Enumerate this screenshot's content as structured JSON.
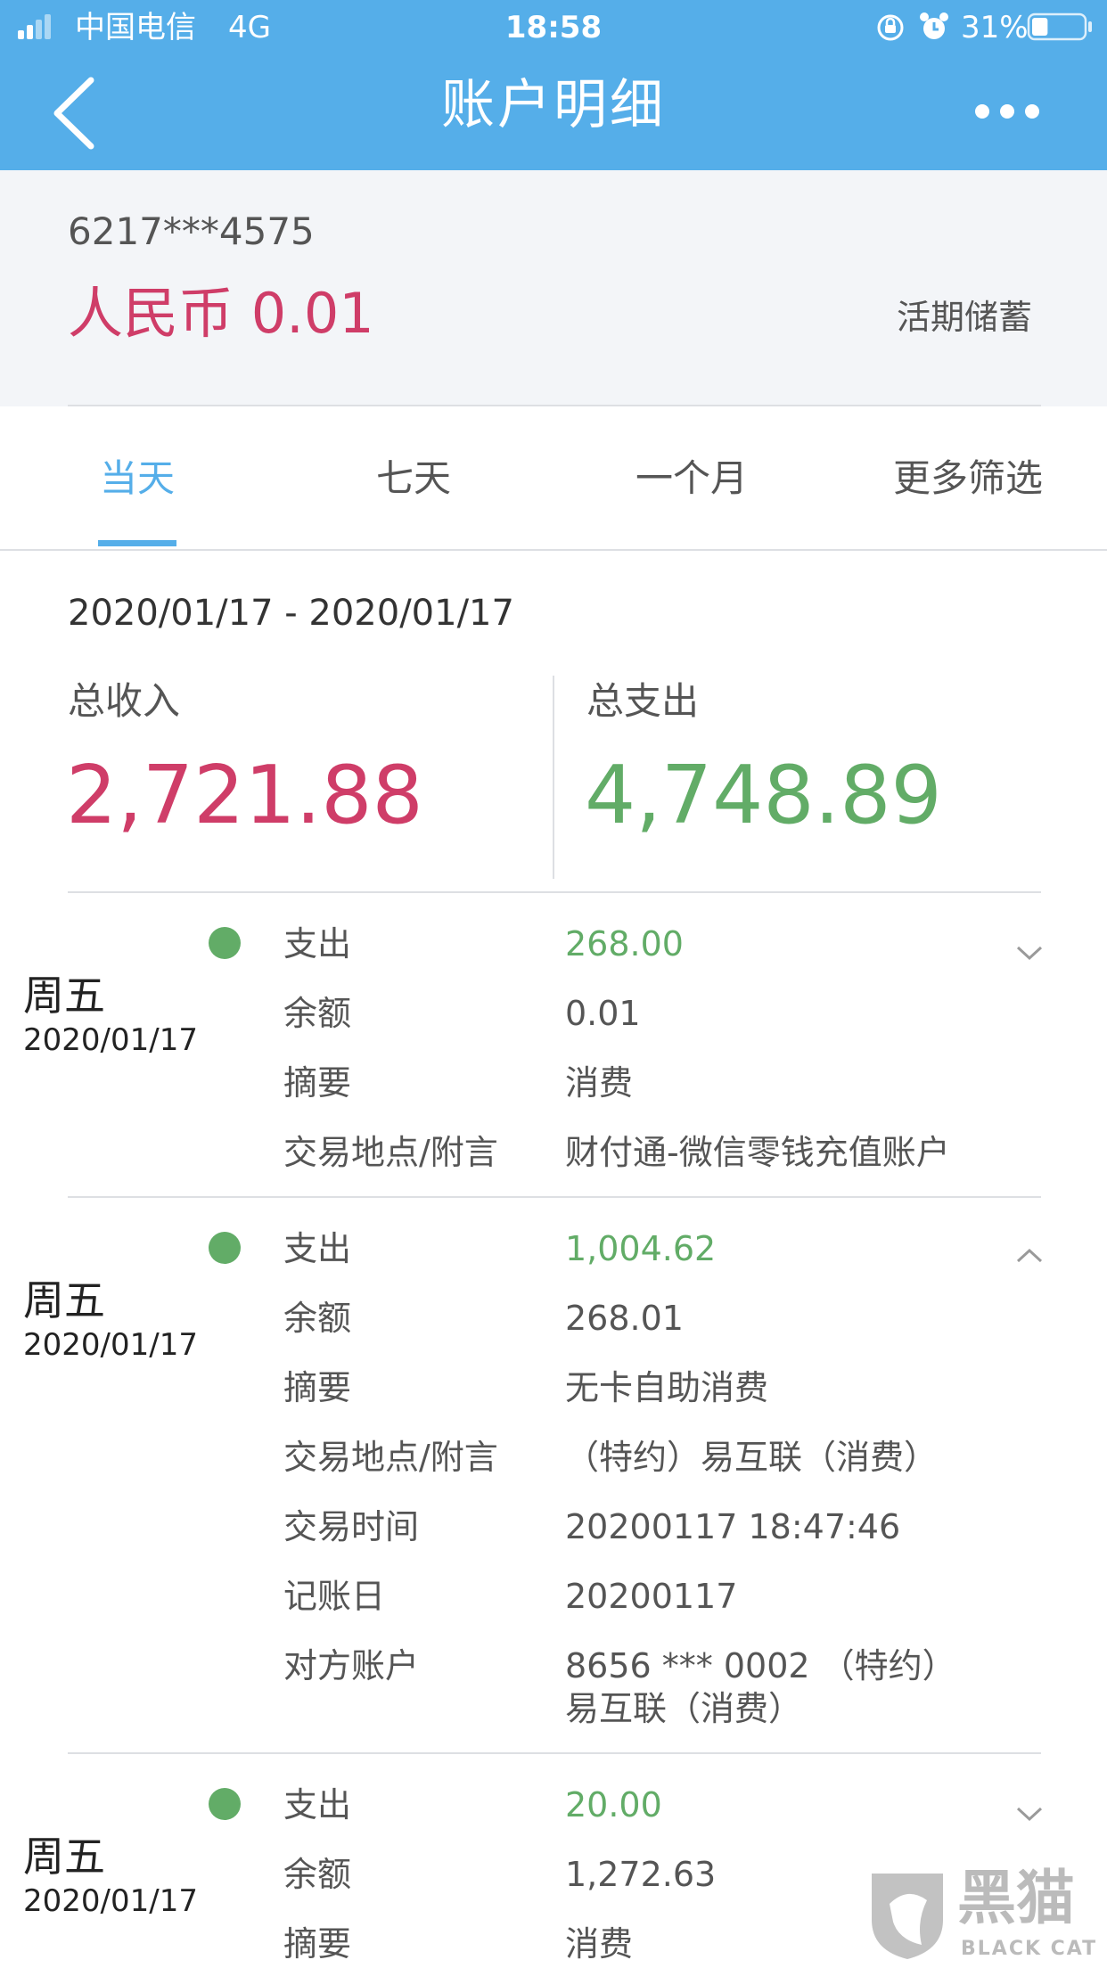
{
  "status_bar": {
    "carrier": "中国电信",
    "network": "4G",
    "time": "18:58",
    "battery": "31%",
    "battery_level": 0.31
  },
  "header": {
    "title": "账户明细"
  },
  "account": {
    "number": "6217***4575",
    "balance": "人民币 0.01",
    "type": "活期储蓄"
  },
  "tabs": [
    {
      "label": "当天"
    },
    {
      "label": "七天"
    },
    {
      "label": "一个月"
    },
    {
      "label": "更多筛选"
    }
  ],
  "summary": {
    "date_range": "2020/01/17 - 2020/01/17",
    "income_label": "总收入",
    "income_value": "2,721.88",
    "expense_label": "总支出",
    "expense_value": "4,748.89"
  },
  "transactions": [
    {
      "weekday": "周五",
      "date": "2020/01/17",
      "type_label": "支出",
      "amount": "268.00",
      "balance_label": "余额",
      "balance": "0.01",
      "summary_label": "摘要",
      "summary": "消费",
      "place_label": "交易地点/附言",
      "place": "财付通-微信零钱充值账户"
    },
    {
      "weekday": "周五",
      "date": "2020/01/17",
      "type_label": "支出",
      "amount": "1,004.62",
      "balance_label": "余额",
      "balance": "268.01",
      "summary_label": "摘要",
      "summary": "无卡自助消费",
      "place_label": "交易地点/附言",
      "place": "（特约）易互联（消费）",
      "time_label": "交易时间",
      "time": "20200117 18:47:46",
      "post_label": "记账日",
      "post_date": "20200117",
      "counterparty_label": "对方账户",
      "counterparty_line1": "8656 *** 0002 （特约）",
      "counterparty_line2": "易互联（消费）"
    },
    {
      "weekday": "周五",
      "date": "2020/01/17",
      "type_label": "支出",
      "amount": "20.00",
      "balance_label": "余额",
      "balance": "1,272.63",
      "summary_label": "摘要",
      "summary": "消费"
    }
  ],
  "watermark": {
    "cn": "黑猫",
    "en": "BLACK CAT"
  },
  "colors": {
    "header": "#55aee9",
    "income": "#cf3d68",
    "expense": "#62ac67",
    "tab_active": "#55aee9"
  }
}
